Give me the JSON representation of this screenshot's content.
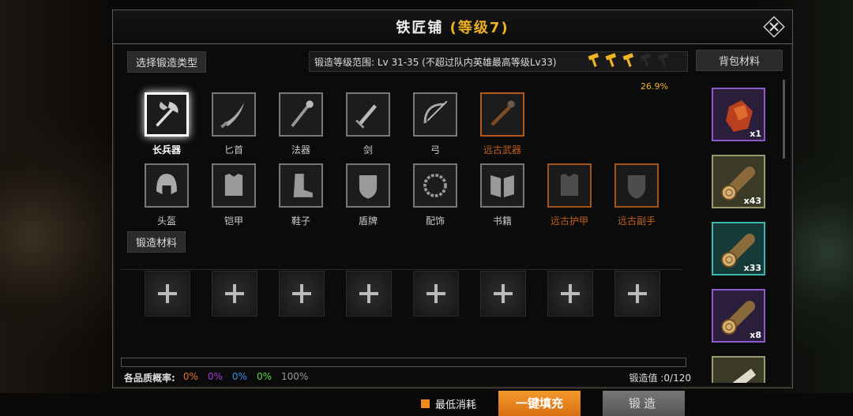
{
  "title": {
    "name": "铁匠铺",
    "level": "(等级7)"
  },
  "select_type_label": "选择锻造类型",
  "range_text": "锻造等级范围: Lv 31-35  (不超过队内英雄最高等级Lv33)",
  "progress_pct": "26.9%",
  "hammers": {
    "filled": 3,
    "total": 5
  },
  "types_row1": [
    {
      "label": "长兵器",
      "icon": "halberd-icon",
      "selected": true,
      "ancient": false
    },
    {
      "label": "匕首",
      "icon": "dagger-icon",
      "selected": false,
      "ancient": false
    },
    {
      "label": "法器",
      "icon": "staff-icon",
      "selected": false,
      "ancient": false
    },
    {
      "label": "剑",
      "icon": "sword-icon",
      "selected": false,
      "ancient": false
    },
    {
      "label": "弓",
      "icon": "bow-icon",
      "selected": false,
      "ancient": false
    },
    {
      "label": "远古武器",
      "icon": "ancient-weapon-icon",
      "selected": false,
      "ancient": true
    }
  ],
  "types_row2": [
    {
      "label": "头盔",
      "icon": "helmet-icon",
      "ancient": false
    },
    {
      "label": "铠甲",
      "icon": "armor-icon",
      "ancient": false
    },
    {
      "label": "鞋子",
      "icon": "boots-icon",
      "ancient": false
    },
    {
      "label": "盾牌",
      "icon": "shield-icon",
      "ancient": false
    },
    {
      "label": "配饰",
      "icon": "necklace-icon",
      "ancient": false
    },
    {
      "label": "书籍",
      "icon": "book-icon",
      "ancient": false
    },
    {
      "label": "远古护甲",
      "icon": "ancient-armor-icon",
      "ancient": true
    },
    {
      "label": "远古副手",
      "icon": "ancient-offhand-icon",
      "ancient": true
    }
  ],
  "materials_label": "锻造材料",
  "material_slot_count": 8,
  "quality": {
    "label": "各品质概率:",
    "values": [
      {
        "text": "0%",
        "color": "#e8712b"
      },
      {
        "text": "0%",
        "color": "#a23be0"
      },
      {
        "text": "0%",
        "color": "#3b8de8"
      },
      {
        "text": "0%",
        "color": "#5ed84a"
      },
      {
        "text": "100%",
        "color": "#999999"
      }
    ]
  },
  "forge_value": "锻造值 :0/120",
  "min_consume_label": "最低消耗",
  "fill_button": "一键填充",
  "forge_button": "锻造",
  "backpack_label": "背包材料",
  "inventory": [
    {
      "count": "x1",
      "icon": "ore-icon",
      "border": "#8a5ad0",
      "bg": "#2a1e3a"
    },
    {
      "count": "x43",
      "icon": "log-icon",
      "border": "#9a9a70",
      "bg": "#3a3a26"
    },
    {
      "count": "x33",
      "icon": "log-icon",
      "border": "#3ab8b0",
      "bg": "#163a38"
    },
    {
      "count": "x8",
      "icon": "log-icon",
      "border": "#8a5ad0",
      "bg": "#2a1e3a"
    },
    {
      "count": "",
      "icon": "cloth-icon",
      "border": "#9a9a70",
      "bg": "#3a3a26"
    }
  ]
}
